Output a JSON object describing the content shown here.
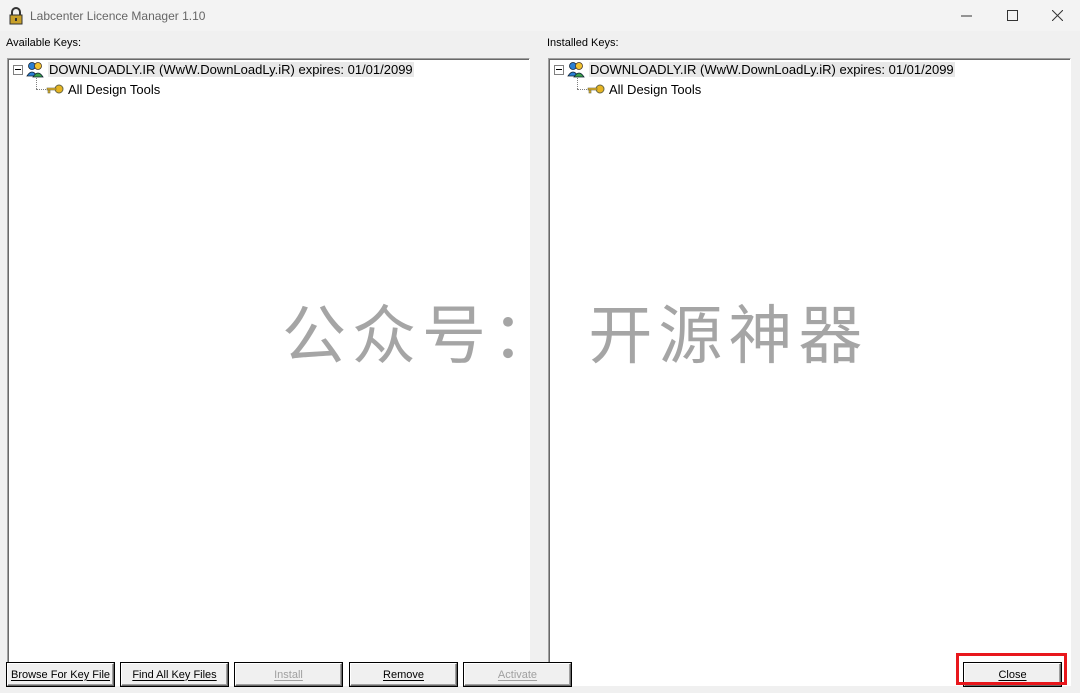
{
  "window": {
    "title": "Labcenter Licence Manager 1.10",
    "icon": "padlock-icon"
  },
  "available": {
    "label": "Available Keys:",
    "tree": {
      "root": "DOWNLOADLY.IR (WwW.DownLoadLy.iR) expires: 01/01/2099",
      "child": "All Design Tools"
    }
  },
  "installed": {
    "label": "Installed Keys:",
    "tree": {
      "root": "DOWNLOADLY.IR (WwW.DownLoadLy.iR) expires: 01/01/2099",
      "child": "All Design Tools"
    }
  },
  "buttons": {
    "browse": "Browse For Key File",
    "find": "Find All Key Files",
    "install": "Install",
    "remove": "Remove",
    "activate": "Activate",
    "close": "Close"
  },
  "watermark": "公众号： 开源神器",
  "colors": {
    "highlight": "#e8171c",
    "disabled_text": "#a0a0a0"
  }
}
